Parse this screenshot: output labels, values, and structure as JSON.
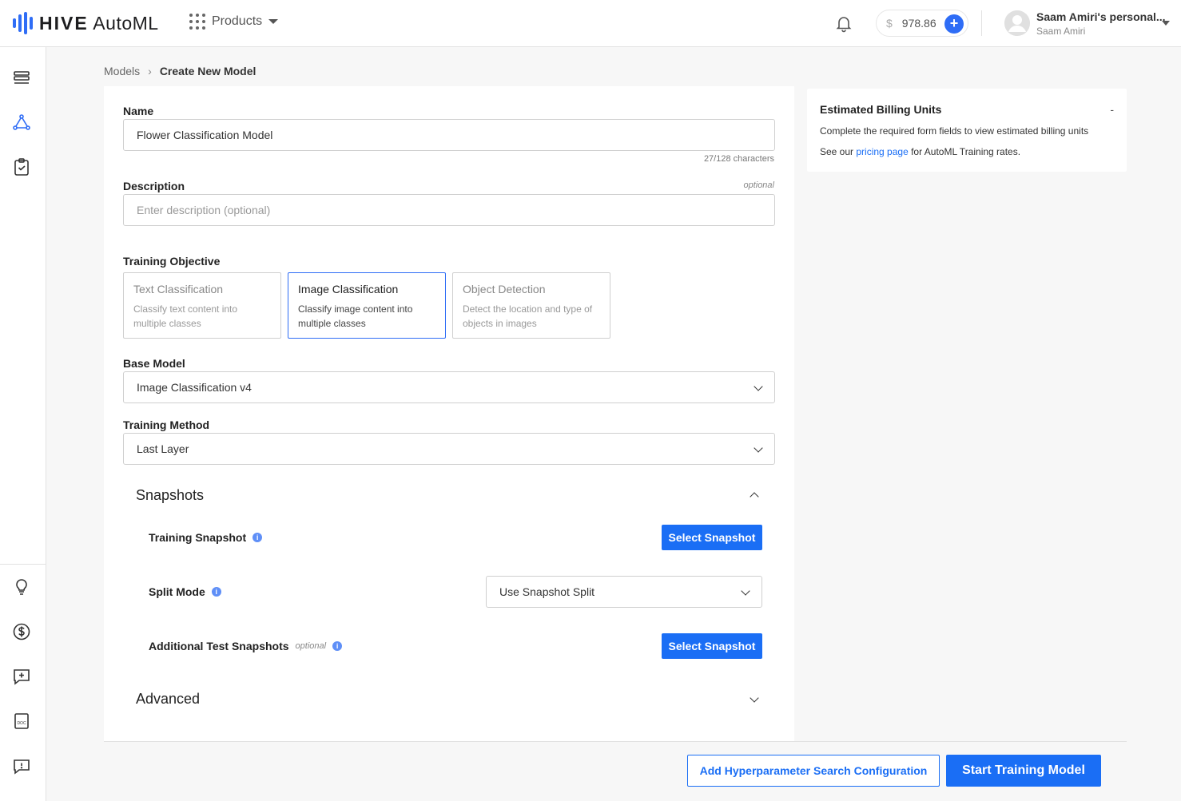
{
  "brand": {
    "name_bold": "HIVE",
    "name_rest": " AutoML",
    "accent": "#1a6ef5"
  },
  "header": {
    "products_label": "Products",
    "balance_currency": "$",
    "balance_value": "978.86",
    "add_funds": "+",
    "user_name": "Saam Amiri's personal...",
    "user_sub": "Saam Amiri"
  },
  "sidebar": {
    "top_icons": [
      "list-icon",
      "model-icon",
      "clipboard-check-icon"
    ],
    "bottom_icons": [
      "lightbulb-icon",
      "dollar-icon",
      "feedback-icon",
      "doc-icon",
      "chat-icon"
    ]
  },
  "breadcrumb": {
    "parent": "Models",
    "separator": "›",
    "current": "Create New Model"
  },
  "form": {
    "name_label": "Name",
    "name_value": "Flower Classification Model",
    "name_counter": "27/128 characters",
    "description_label": "Description",
    "description_optional": "optional",
    "description_placeholder": "Enter description (optional)",
    "objective_label": "Training Objective",
    "objectives": [
      {
        "title": "Text Classification",
        "desc": "Classify text content into multiple classes"
      },
      {
        "title": "Image Classification",
        "desc": "Classify image content into multiple classes"
      },
      {
        "title": "Object Detection",
        "desc": "Detect the location and type of objects in images"
      }
    ],
    "selected_objective": "Image Classification",
    "base_model_label": "Base Model",
    "base_model_value": "Image Classification v4",
    "training_method_label": "Training Method",
    "training_method_value": "Last Layer"
  },
  "snapshots": {
    "title": "Snapshots",
    "training_snapshot_label": "Training Snapshot",
    "select_snapshot_label": "Select Snapshot",
    "split_mode_label": "Split Mode",
    "split_mode_value": "Use Snapshot Split",
    "additional_label": "Additional Test Snapshots",
    "additional_optional": "optional",
    "select_snapshot_label_2": "Select Snapshot",
    "info_glyph": "i"
  },
  "advanced": {
    "title": "Advanced"
  },
  "billing": {
    "title": "Estimated Billing Units",
    "value": "-",
    "line1": "Complete the required form fields to view estimated billing units",
    "line2_pre": "See our ",
    "line2_link": "pricing page",
    "line2_post": " for AutoML Training rates."
  },
  "footer": {
    "hyperparam_button": "Add Hyperparameter Search Configuration",
    "start_button": "Start Training Model"
  }
}
